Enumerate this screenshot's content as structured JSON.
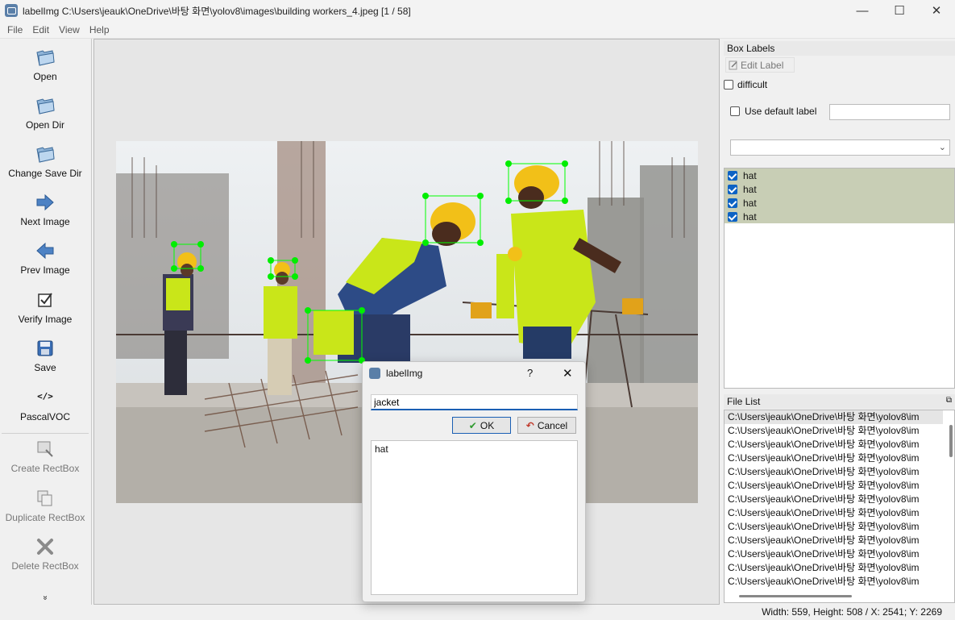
{
  "window": {
    "title": "labelImg C:\\Users\\jeauk\\OneDrive\\바탕 화면\\yolov8\\images\\building workers_4.jpeg [1 / 58]",
    "minimize": "—",
    "maximize": "☐",
    "close": "✕"
  },
  "menu": [
    "File",
    "Edit",
    "View",
    "Help"
  ],
  "toolbar": {
    "open": "Open",
    "open_dir": "Open Dir",
    "change_save_dir": "Change Save Dir",
    "next_image": "Next Image",
    "prev_image": "Prev Image",
    "verify_image": "Verify Image",
    "save": "Save",
    "format": "PascalVOC",
    "format_icon_text": "</>",
    "create_rectbox": "Create RectBox",
    "duplicate_rectbox": "Duplicate RectBox",
    "delete_rectbox": "Delete RectBox",
    "more": "»"
  },
  "box_labels": {
    "title": "Box Labels",
    "edit_label": "Edit Label",
    "difficult": "difficult",
    "use_default_label": "Use default label",
    "default_label_value": "",
    "items": [
      "hat",
      "hat",
      "hat",
      "hat"
    ]
  },
  "file_list": {
    "title": "File List",
    "items": [
      "C:\\Users\\jeauk\\OneDrive\\바탕 화면\\yolov8\\im",
      "C:\\Users\\jeauk\\OneDrive\\바탕 화면\\yolov8\\im",
      "C:\\Users\\jeauk\\OneDrive\\바탕 화면\\yolov8\\im",
      "C:\\Users\\jeauk\\OneDrive\\바탕 화면\\yolov8\\im",
      "C:\\Users\\jeauk\\OneDrive\\바탕 화면\\yolov8\\im",
      "C:\\Users\\jeauk\\OneDrive\\바탕 화면\\yolov8\\im",
      "C:\\Users\\jeauk\\OneDrive\\바탕 화면\\yolov8\\im",
      "C:\\Users\\jeauk\\OneDrive\\바탕 화면\\yolov8\\im",
      "C:\\Users\\jeauk\\OneDrive\\바탕 화면\\yolov8\\im",
      "C:\\Users\\jeauk\\OneDrive\\바탕 화면\\yolov8\\im",
      "C:\\Users\\jeauk\\OneDrive\\바탕 화면\\yolov8\\im",
      "C:\\Users\\jeauk\\OneDrive\\바탕 화면\\yolov8\\im",
      "C:\\Users\\jeauk\\OneDrive\\바탕 화면\\yolov8\\im"
    ]
  },
  "dialog": {
    "title": "labelImg",
    "help": "?",
    "close": "✕",
    "input_value": "jacket",
    "ok": "OK",
    "cancel": "Cancel",
    "labels": [
      "hat"
    ]
  },
  "status": "Width: 559, Height: 508 / X: 2541; Y: 2269",
  "colors": {
    "selection": "#c8ceb5",
    "box_outline": "#00ff00",
    "accent": "#0c62c4"
  }
}
